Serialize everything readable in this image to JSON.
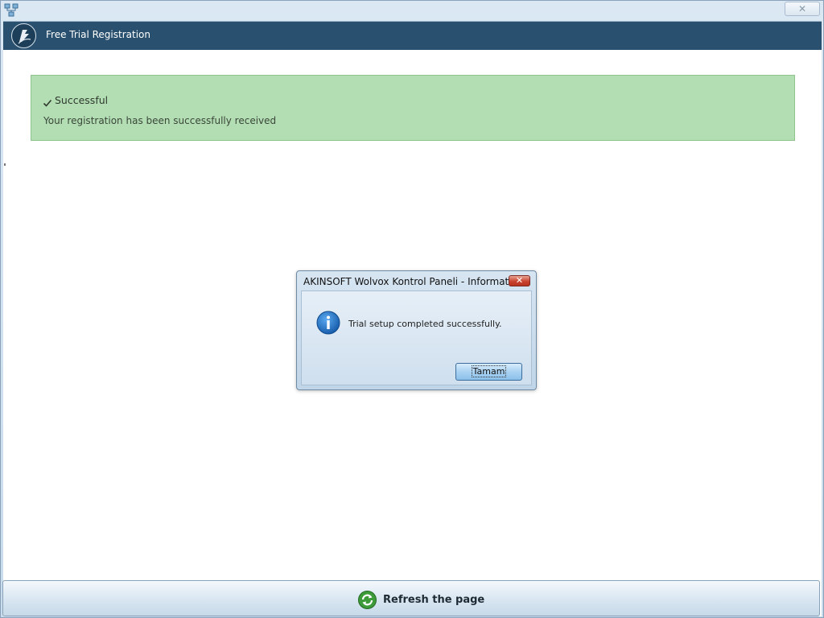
{
  "window": {
    "close_glyph": "✕"
  },
  "header": {
    "title": "Free Trial Registration"
  },
  "alert": {
    "heading": "Successful",
    "message": "Your registration has been successfully received",
    "color": "#b3ddb3"
  },
  "dialog": {
    "title": "AKINSOFT Wolvox Kontrol Paneli - Information",
    "close_glyph": "✕",
    "message": "Trial setup completed successfully.",
    "ok_label": "Tamam",
    "icon": "info-icon"
  },
  "footer": {
    "refresh_label": "Refresh the page",
    "icon": "refresh-icon"
  },
  "colors": {
    "header_bg": "#29506e",
    "success_bg": "#b3ddb3",
    "info_blue": "#1a6fc4"
  }
}
